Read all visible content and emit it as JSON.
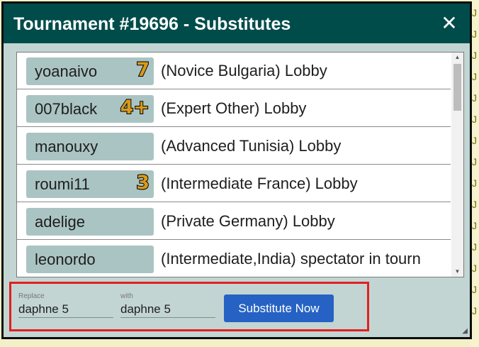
{
  "dialog": {
    "title": "Tournament #19696 - Substitutes",
    "close_glyph": "✕"
  },
  "players": [
    {
      "name": "yoanaivo",
      "level": "7",
      "description": "(Novice Bulgaria) Lobby"
    },
    {
      "name": "007black",
      "level": "4+",
      "description": "(Expert Other) Lobby"
    },
    {
      "name": "manouxy",
      "level": "",
      "description": "(Advanced Tunisia) Lobby"
    },
    {
      "name": "roumi11",
      "level": "3",
      "description": "(Intermediate France) Lobby"
    },
    {
      "name": "adelige",
      "level": "",
      "description": "(Private Germany) Lobby"
    },
    {
      "name": "leonordo",
      "level": "",
      "description": "(Intermediate,India) spectator in tourn"
    }
  ],
  "substitute_form": {
    "replace_label": "Replace",
    "replace_value": "daphne 5",
    "with_label": "with",
    "with_value": "daphne 5",
    "button_label": "Substitute Now"
  },
  "colors": {
    "title_bar": "#004c4a",
    "dialog_bg": "#c2d5d3",
    "chip_bg": "#aac4c3",
    "button_bg": "#2562c4",
    "highlight_border": "#e1201f",
    "level_badge": "#d89a1a"
  }
}
